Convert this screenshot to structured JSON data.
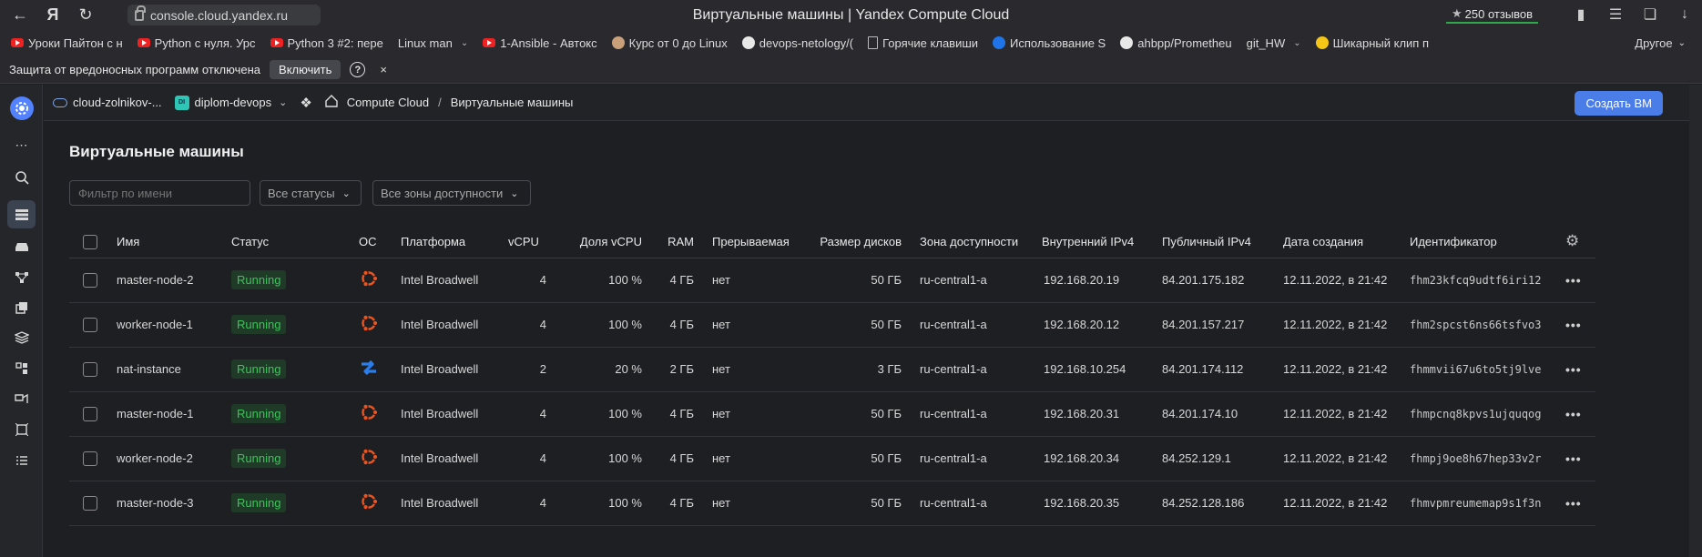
{
  "browser": {
    "url": "console.cloud.yandex.ru",
    "page_title": "Виртуальные машины | Yandex Compute Cloud",
    "reviews": "250 отзывов",
    "bookmarks": [
      {
        "label": "Уроки Пайтон с н",
        "icon": "youtube-icon"
      },
      {
        "label": "Python с нуля. Урс",
        "icon": "youtube-icon"
      },
      {
        "label": "Python 3 #2: пере",
        "icon": "youtube-icon"
      },
      {
        "label": "Linux man",
        "icon": "folder-icon",
        "chevron": true
      },
      {
        "label": "1-Ansible - Автокс",
        "icon": "youtube-icon"
      },
      {
        "label": "Курс от 0 до Linux",
        "icon": "site-icon"
      },
      {
        "label": "devops-netology/(",
        "icon": "github-icon"
      },
      {
        "label": "Горячие клавиши",
        "icon": "document-icon"
      },
      {
        "label": "Использование S",
        "icon": "globe-icon"
      },
      {
        "label": "ahbpp/Prometheu",
        "icon": "github-icon"
      },
      {
        "label": "git_HW",
        "icon": "folder-icon",
        "chevron": true
      },
      {
        "label": "Шикарный клип п",
        "icon": "play-icon"
      }
    ],
    "bookmarks_other": "Другое",
    "warning": {
      "text": "Защита от вредоносных программ отключена",
      "button": "Включить",
      "help": "?",
      "close": "×"
    }
  },
  "header": {
    "cloud": "cloud-zolnikov-...",
    "folder_badge": "DI",
    "folder": "diplom-devops",
    "crumb_service": "Compute Cloud",
    "crumb_sep": "/",
    "crumb_current": "Виртуальные машины",
    "create_button": "Создать ВМ"
  },
  "main": {
    "title": "Виртуальные машины",
    "filter_placeholder": "Фильтр по имени",
    "status_select": "Все статусы",
    "zone_select": "Все зоны доступности"
  },
  "table": {
    "columns": [
      "Имя",
      "Статус",
      "ОС",
      "Платформа",
      "vCPU",
      "Доля vCPU",
      "RAM",
      "Прерываемая",
      "Размер дисков",
      "Зона доступности",
      "Внутренний IPv4",
      "Публичный IPv4",
      "Дата создания",
      "Идентификатор"
    ],
    "rows": [
      {
        "name": "master-node-2",
        "status": "Running",
        "os": "ubuntu",
        "platform": "Intel Broadwell",
        "vcpu": "4",
        "share": "100 %",
        "ram": "4 ГБ",
        "preemptible": "нет",
        "disk": "50 ГБ",
        "zone": "ru-central1-a",
        "internal_ip": "192.168.20.19",
        "public_ip": "84.201.175.182",
        "created": "12.11.2022, в 21:42",
        "id": "fhm23kfcq9udtf6iri12"
      },
      {
        "name": "worker-node-1",
        "status": "Running",
        "os": "ubuntu",
        "platform": "Intel Broadwell",
        "vcpu": "4",
        "share": "100 %",
        "ram": "4 ГБ",
        "preemptible": "нет",
        "disk": "50 ГБ",
        "zone": "ru-central1-a",
        "internal_ip": "192.168.20.12",
        "public_ip": "84.201.157.217",
        "created": "12.11.2022, в 21:42",
        "id": "fhm2spcst6ns66tsfvo3"
      },
      {
        "name": "nat-instance",
        "status": "Running",
        "os": "nat",
        "platform": "Intel Broadwell",
        "vcpu": "2",
        "share": "20 %",
        "ram": "2 ГБ",
        "preemptible": "нет",
        "disk": "3 ГБ",
        "zone": "ru-central1-a",
        "internal_ip": "192.168.10.254",
        "public_ip": "84.201.174.112",
        "created": "12.11.2022, в 21:42",
        "id": "fhmmvii67u6to5tj9lve"
      },
      {
        "name": "master-node-1",
        "status": "Running",
        "os": "ubuntu",
        "platform": "Intel Broadwell",
        "vcpu": "4",
        "share": "100 %",
        "ram": "4 ГБ",
        "preemptible": "нет",
        "disk": "50 ГБ",
        "zone": "ru-central1-a",
        "internal_ip": "192.168.20.31",
        "public_ip": "84.201.174.10",
        "created": "12.11.2022, в 21:42",
        "id": "fhmpcnq8kpvs1ujquqog"
      },
      {
        "name": "worker-node-2",
        "status": "Running",
        "os": "ubuntu",
        "platform": "Intel Broadwell",
        "vcpu": "4",
        "share": "100 %",
        "ram": "4 ГБ",
        "preemptible": "нет",
        "disk": "50 ГБ",
        "zone": "ru-central1-a",
        "internal_ip": "192.168.20.34",
        "public_ip": "84.252.129.1",
        "created": "12.11.2022, в 21:42",
        "id": "fhmpj9oe8h67hep33v2r"
      },
      {
        "name": "master-node-3",
        "status": "Running",
        "os": "ubuntu",
        "platform": "Intel Broadwell",
        "vcpu": "4",
        "share": "100 %",
        "ram": "4 ГБ",
        "preemptible": "нет",
        "disk": "50 ГБ",
        "zone": "ru-central1-a",
        "internal_ip": "192.168.20.35",
        "public_ip": "84.252.128.186",
        "created": "12.11.2022, в 21:42",
        "id": "fhmvpmreumemap9s1f3n"
      }
    ]
  },
  "colors": {
    "accent": "#4a7de8",
    "running_text": "#3ec25c",
    "running_bg": "#1f3b27",
    "ubuntu": "#e95420",
    "nat": "#2b7de9"
  }
}
